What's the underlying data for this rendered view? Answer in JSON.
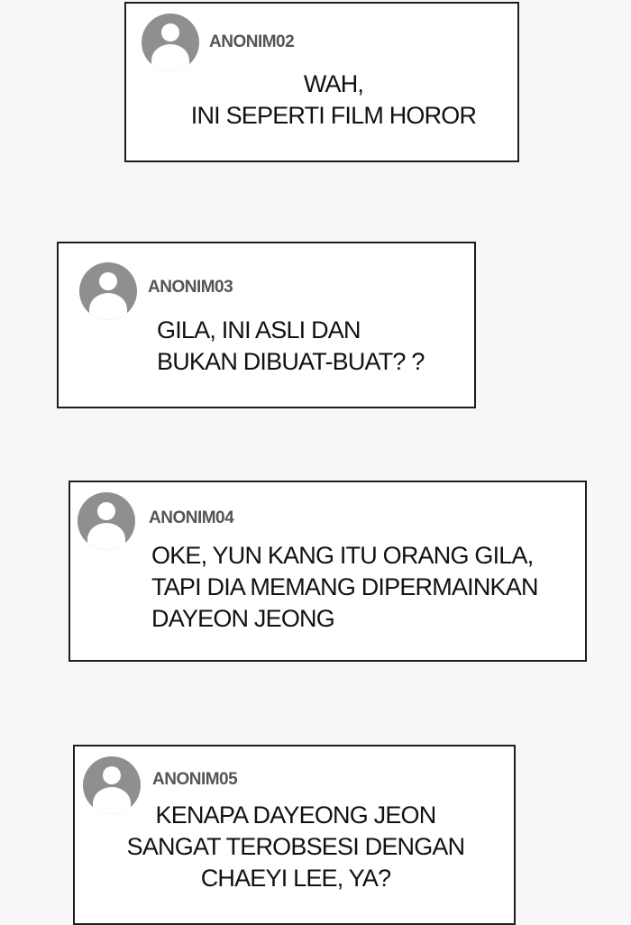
{
  "comments": [
    {
      "username": "ANONIM02",
      "text": "WAH,\nINI SEPERTI FILM HOROR"
    },
    {
      "username": "ANONIM03",
      "text": "GILA, INI ASLI DAN\nBUKAN DIBUAT-BUAT? ?"
    },
    {
      "username": "ANONIM04",
      "text": "OKE, YUN KANG ITU ORANG GILA,\nTAPI DIA MEMANG DIPERMAINKAN\nDAYEON JEONG"
    },
    {
      "username": "ANONIM05",
      "text": "KENAPA DAYEONG JEON\nSANGAT TEROBSESI DENGAN\nCHAEYI LEE, YA?"
    }
  ],
  "icons": {
    "avatar": "user-avatar-icon"
  }
}
